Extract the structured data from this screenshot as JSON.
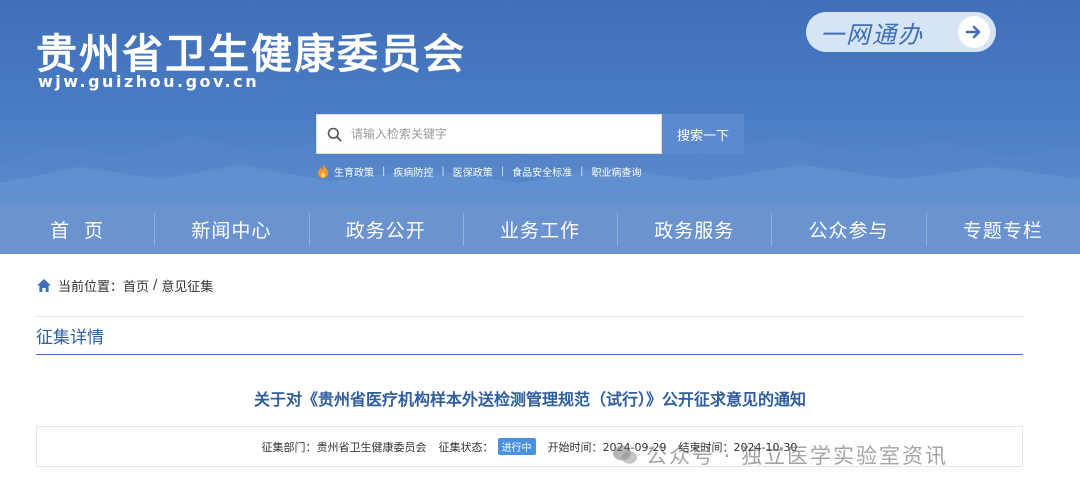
{
  "header": {
    "site_title": "贵州省卫生健康委员会",
    "site_domain": "wjw.guizhou.gov.cn",
    "service_button_label": "一网通办",
    "search": {
      "placeholder": "请输入检索关键字",
      "button_label": "搜索一下"
    },
    "hot_links": [
      "生育政策",
      "疾病防控",
      "医保政策",
      "食品安全标准",
      "职业病查询"
    ]
  },
  "nav": {
    "items": [
      "首  页",
      "新闻中心",
      "政务公开",
      "业务工作",
      "政务服务",
      "公众参与",
      "专题专栏"
    ]
  },
  "breadcrumb": {
    "prefix": "当前位置：",
    "items": [
      "首页",
      "意见征集"
    ],
    "separator": "/"
  },
  "section": {
    "title": "征集详情"
  },
  "article": {
    "title": "关于对《贵州省医疗机构样本外送检测管理规范（试行）》公开征求意见的通知",
    "meta": {
      "dept_label": "征集部门：",
      "dept_value": "贵州省卫生健康委员会",
      "status_label": "征集状态：",
      "status_value": "进行中",
      "start_label": "开始时间：",
      "start_value": "2024-09-29",
      "end_label": "结束时间：",
      "end_value": "2024-10-30"
    }
  },
  "watermark": {
    "text": "公众号 · 独立医学实验室资讯"
  },
  "colors": {
    "banner": "#4a7cc4",
    "nav": "#6a93cf",
    "accent": "#2f5e9e",
    "status": "#4a90e2"
  }
}
